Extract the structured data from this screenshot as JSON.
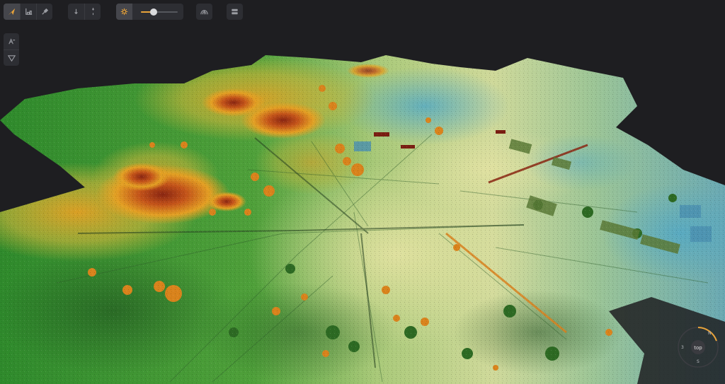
{
  "toolbar": {
    "tools": [
      {
        "icon": "navigate-arrow-icon",
        "active": true
      },
      {
        "icon": "measure-profile-icon",
        "active": false
      },
      {
        "icon": "eyedropper-icon",
        "active": false
      },
      {
        "icon": "move-down-icon",
        "active": false
      },
      {
        "icon": "move-up-icon",
        "active": false
      },
      {
        "icon": "point-light-icon",
        "active": true
      },
      {
        "icon": "dome-view-icon",
        "active": false
      },
      {
        "icon": "layers-panel-icon",
        "active": false
      }
    ],
    "point_size_level": 0.35
  },
  "side_tools": [
    {
      "icon": "elevation-ramp-icon"
    },
    {
      "icon": "filter-icon"
    }
  ],
  "compass": {
    "label": "top",
    "north": "N",
    "south": "S",
    "west": "3"
  },
  "colors": {
    "accent": "#e8a33a",
    "panel": "#2d2e33",
    "background": "#1e1e21",
    "ramp_low": "#4ea7c8",
    "ramp_mid_low": "#c9d98a",
    "ramp_mid": "#4d9a3a",
    "ramp_mid_high": "#e3a024",
    "ramp_high": "#8a2612"
  }
}
